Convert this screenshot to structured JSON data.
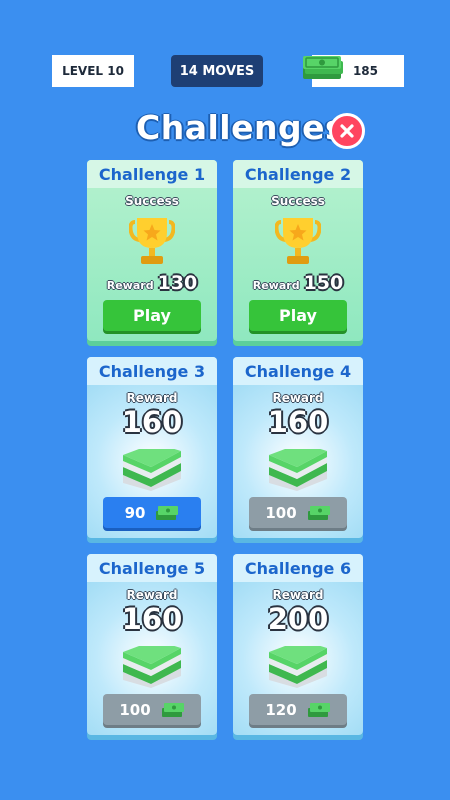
{
  "hud": {
    "level": "LEVEL 10",
    "moves": "14 MOVES",
    "money": "185",
    "money_icon": "cash-icon"
  },
  "title": "Challenges",
  "close_icon": "close-icon",
  "colors": {
    "background": "#3b8ff0",
    "completed_card": "#9eecc6",
    "locked_card": "#a6ddf5",
    "play_button": "#36c43a",
    "price_afford": "#2a7ff0",
    "price_locked": "#8e9da6",
    "header_text": "#1c66cc",
    "close_button": "#ff4560"
  },
  "challenges": [
    {
      "name": "Challenge 1",
      "status": "Success",
      "reward_label": "Reward",
      "reward": "130",
      "button": "Play"
    },
    {
      "name": "Challenge 2",
      "status": "Success",
      "reward_label": "Reward",
      "reward": "150",
      "button": "Play"
    },
    {
      "name": "Challenge 3",
      "reward_label": "Reward",
      "reward": "160",
      "price": "90"
    },
    {
      "name": "Challenge 4",
      "reward_label": "Reward",
      "reward": "160",
      "price": "100"
    },
    {
      "name": "Challenge 5",
      "reward_label": "Reward",
      "reward": "160",
      "price": "100"
    },
    {
      "name": "Challenge 6",
      "reward_label": "Reward",
      "reward": "200",
      "price": "120"
    }
  ]
}
